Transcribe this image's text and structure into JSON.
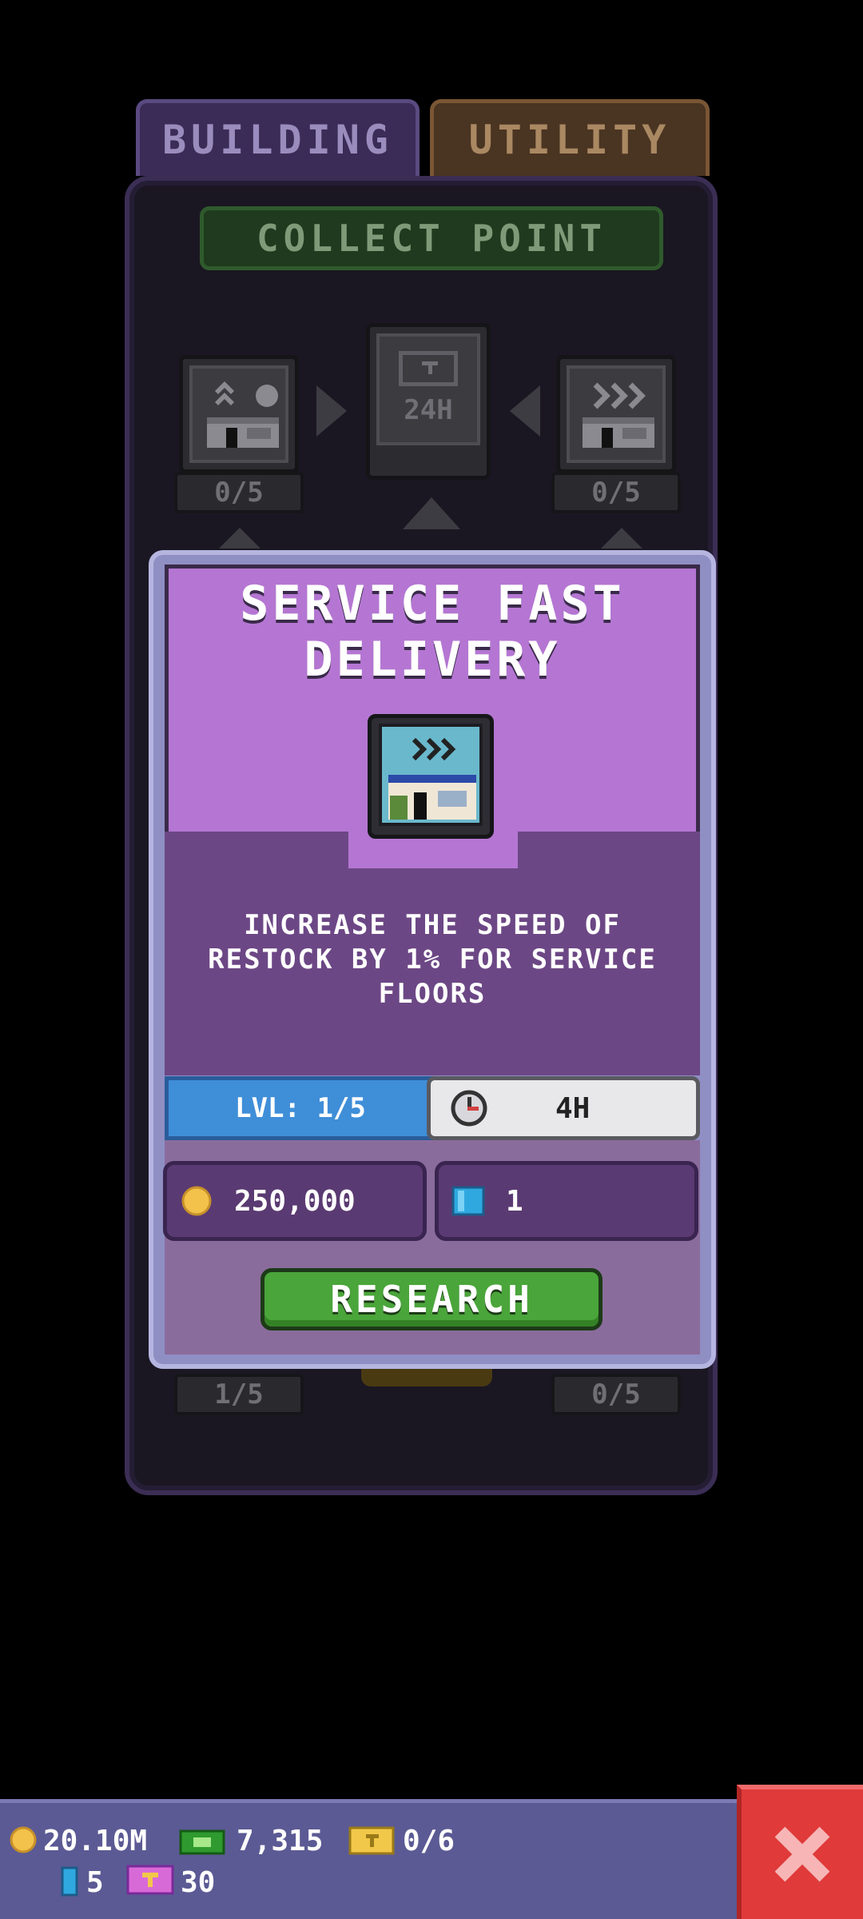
{
  "tabs": {
    "building": "BUILDING",
    "utility": "UTILITY"
  },
  "section_title": "COLLECT POINT",
  "tree": {
    "center_node_label": "24H",
    "left_count": "0/5",
    "right_count": "0/5",
    "bottom_left_count": "1/5",
    "bottom_right_count": "0/5"
  },
  "dialog": {
    "title_line1": "SERVICE FAST",
    "title_line2": "DELIVERY",
    "description_line1": "INCREASE THE SPEED OF",
    "description_line2": "RESTOCK BY 1% FOR SERVICE",
    "description_line3": "FLOORS",
    "level": "LVL: 1/5",
    "duration": "4H",
    "cost_coins": "250,000",
    "cost_gems": "1",
    "research_label": "RESEARCH"
  },
  "status": {
    "coins": "20.10M",
    "cash": "7,315",
    "tickets": "0/6",
    "gems": "5",
    "vip_tickets": "30"
  },
  "colors": {
    "dialog_header": "#b476d2",
    "dialog_body": "#6c4785",
    "level_bar": "#3f8ed8",
    "research_button": "#4aa53a",
    "close_button": "#e03a3a",
    "status_bar": "#5b5a94"
  }
}
